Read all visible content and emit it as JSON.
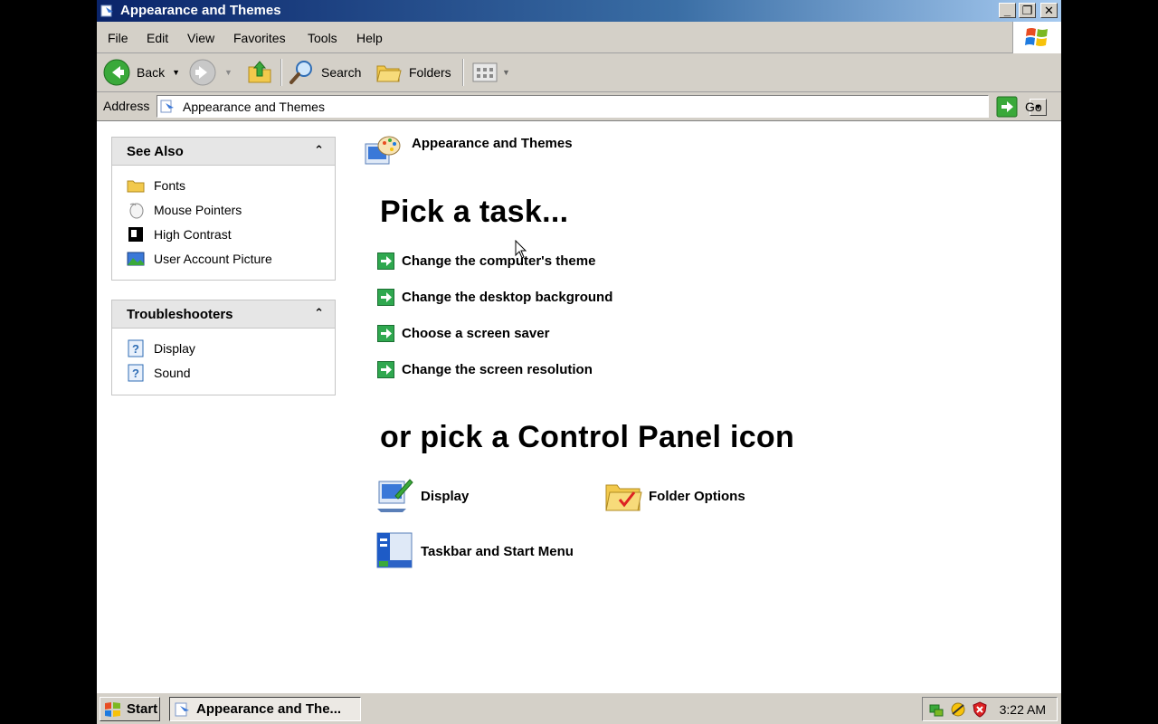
{
  "window": {
    "title": "Appearance and Themes"
  },
  "menu": [
    "File",
    "Edit",
    "View",
    "Favorites",
    "Tools",
    "Help"
  ],
  "toolbar": {
    "back_label": "Back",
    "search_label": "Search",
    "folders_label": "Folders"
  },
  "address": {
    "label": "Address",
    "value": "Appearance and Themes",
    "go_label": "Go"
  },
  "see_also": {
    "title": "See Also",
    "items": [
      {
        "label": "Fonts",
        "icon": "folder-icon"
      },
      {
        "label": "Mouse Pointers",
        "icon": "mouse-icon"
      },
      {
        "label": "High Contrast",
        "icon": "contrast-icon"
      },
      {
        "label": "User Account Picture",
        "icon": "picture-icon"
      }
    ]
  },
  "troubleshooters": {
    "title": "Troubleshooters",
    "items": [
      {
        "label": "Display",
        "icon": "help-icon"
      },
      {
        "label": "Sound",
        "icon": "help-icon"
      }
    ]
  },
  "main": {
    "category_title": "Appearance and Themes",
    "pick_task_heading": "Pick a task...",
    "tasks": [
      "Change the computer's theme",
      "Change the desktop background",
      "Choose a screen saver",
      "Change the screen resolution"
    ],
    "pick_icon_heading": "or pick a Control Panel icon",
    "icons": [
      {
        "label": "Display",
        "icon": "display-icon"
      },
      {
        "label": "Folder Options",
        "icon": "folder-options-icon"
      },
      {
        "label": "Taskbar and Start Menu",
        "icon": "taskbar-icon"
      }
    ]
  },
  "taskbar": {
    "start_label": "Start",
    "active_task": "Appearance and The...",
    "clock": "3:22 AM"
  },
  "colors": {
    "title_bar": "#0a246a",
    "chrome": "#d4d0c8",
    "task_arrow": "#2fa84f"
  }
}
